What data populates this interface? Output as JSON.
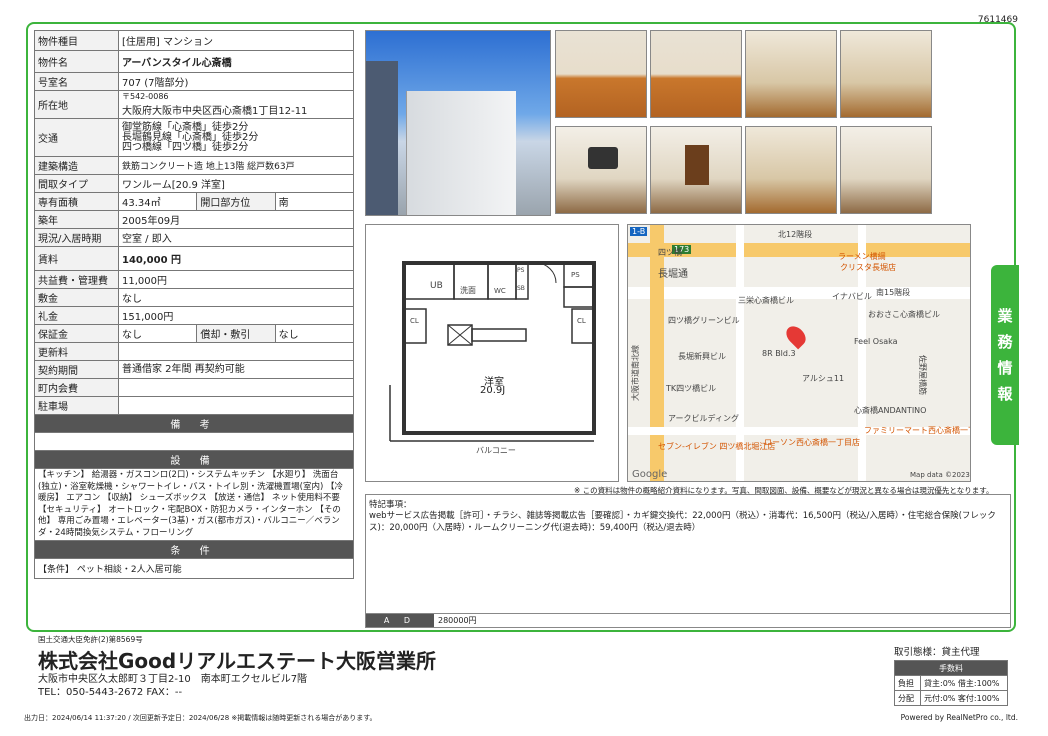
{
  "doc_id": "7611469",
  "property": {
    "type_label": "物件種目",
    "type_value": "[住居用] マンション",
    "name_label": "物件名",
    "name_value": "アーバンスタイル心斎橋",
    "room_label": "号室名",
    "room_value": "707 (7階部分)",
    "location_label": "所在地",
    "postal": "〒542-0086",
    "address": "大阪府大阪市中央区西心斎橋1丁目12-11",
    "transport_label": "交通",
    "transport": [
      "御堂筋線「心斎橋」徒歩2分",
      "長堀鶴見線「心斎橋」徒歩2分",
      "四つ橋線「四ツ橋」徒歩2分"
    ],
    "structure_label": "建築構造",
    "structure_value": "鉄筋コンクリート造 地上13階 総戸数63戸",
    "layout_label": "間取タイプ",
    "layout_value": "ワンルーム[20.9 洋室]",
    "area_label": "専有面積",
    "area_value": "43.34㎡",
    "direction_label": "開口部方位",
    "direction_value": "南",
    "built_label": "築年",
    "built_value": "2005年09月",
    "status_label": "現況/入居時期",
    "status_value": "空室 / 即入",
    "rent_label": "賃料",
    "rent_value": "140,000 円",
    "common_label": "共益費・管理費",
    "common_value": "11,000円",
    "deposit_label": "敷金",
    "deposit_value": "なし",
    "key_money_label": "礼金",
    "key_money_value": "151,000円",
    "guarantee_label": "保証金",
    "guarantee_value": "なし",
    "amortize_label": "償却・敷引",
    "amortize_value": "なし",
    "renewal_label": "更新料",
    "renewal_value": "",
    "contract_label": "契約期間",
    "contract_value": "普通借家 2年間 再契約可能",
    "council_label": "町内会費",
    "council_value": "",
    "parking_label": "駐車場",
    "parking_value": ""
  },
  "sections": {
    "remarks_head": "備 考",
    "equipment_head": "設 備",
    "conditions_head": "条 件"
  },
  "equipment_text": "【キッチン】 給湯器・ガスコンロ(2口)・システムキッチン 【水廻り】 洗面台(独立)・浴室乾燥機・シャワートイレ・バス・トイレ別・洗濯機置場(室内) 【冷暖房】 エアコン 【収納】 シューズボックス 【放送・通信】 ネット使用料不要 【セキュリティ】 オートロック・宅配BOX・防犯カメラ・インターホン 【その他】 専用ごみ置場・エレベーター(3基)・ガス(都市ガス)・バルコニー／ベランダ・24時間換気システム・フローリング",
  "conditions_text": "【条件】 ペット相談・2人入居可能",
  "floorplan": {
    "room_name": "洋室",
    "room_size": "20.9J",
    "balcony": "バルコニー",
    "ub": "UB",
    "washroom": "洗面",
    "wc": "WC",
    "ps": "PS",
    "sb": "SB",
    "cl": "CL"
  },
  "map_labels": [
    "北12階段",
    "ラーメン横綱",
    "クリスタ長堀店",
    "長堀通",
    "四ツ橋グリーンビル",
    "イナバビル",
    "三栄心斎橋ビル",
    "南15階段",
    "おおさこ心斎橋ビル",
    "大阪市道南北線",
    "長堀新興ビル",
    "8R Bld.3",
    "Feel Osaka",
    "TK四ツ橋ビル",
    "アルシュ11",
    "アークビルディング",
    "心斎橋ANDANTINO",
    "セブン-イレブン 四ツ橋北堀江店",
    "ローソン西心斎橋一丁目店",
    "ファミリーマート西心斎橋一丁目店",
    "Google",
    "Map data ©2023",
    "佐野屋橋筋",
    "173",
    "1-B",
    "四ツ橋"
  ],
  "notice": "※ この資料は物件の概略紹介資料になります。写真、間取図面、設備、概要などが現況と異なる場合は現況優先となります。",
  "remarks": {
    "title": "特記事項：",
    "body": "webサービス広告掲載［許可］・チラシ、雑誌等掲載広告［要確認］・カギ鍵交換代：22,000円（税込）・消毒代：16,500円（税込/入居時）・住宅総合保険(フレックス)：20,000円（入居時）・ルームクリーニング代(退去時)：59,400円（税込/退去時）",
    "ad_label": "A D",
    "ad_value": "280000円"
  },
  "side_tab": [
    "業",
    "務",
    "情",
    "報"
  ],
  "footer": {
    "license": "国土交通大臣免許(2)第8569号",
    "company": "株式会社Goodリアルエステート大阪営業所",
    "address": "大阪市中央区久太郎町３丁目2-10　南本町エクセルビル7階",
    "tel": "TEL：050-5443-2672 FAX：--",
    "deal_title": "取引態様：貸主代理",
    "fee_head": "手数料",
    "burden_label": "負担",
    "burden_value": "貸主:0% 借主:100%",
    "split_label": "分配",
    "split_value": "元付:0% 客付:100%",
    "output_line": "出力日：2024/06/14 11:37:20 / 次回更新予定日：2024/06/28 ※掲載情報は随時更新される場合があります。",
    "powered": "Powered by RealNetPro co., ltd."
  }
}
